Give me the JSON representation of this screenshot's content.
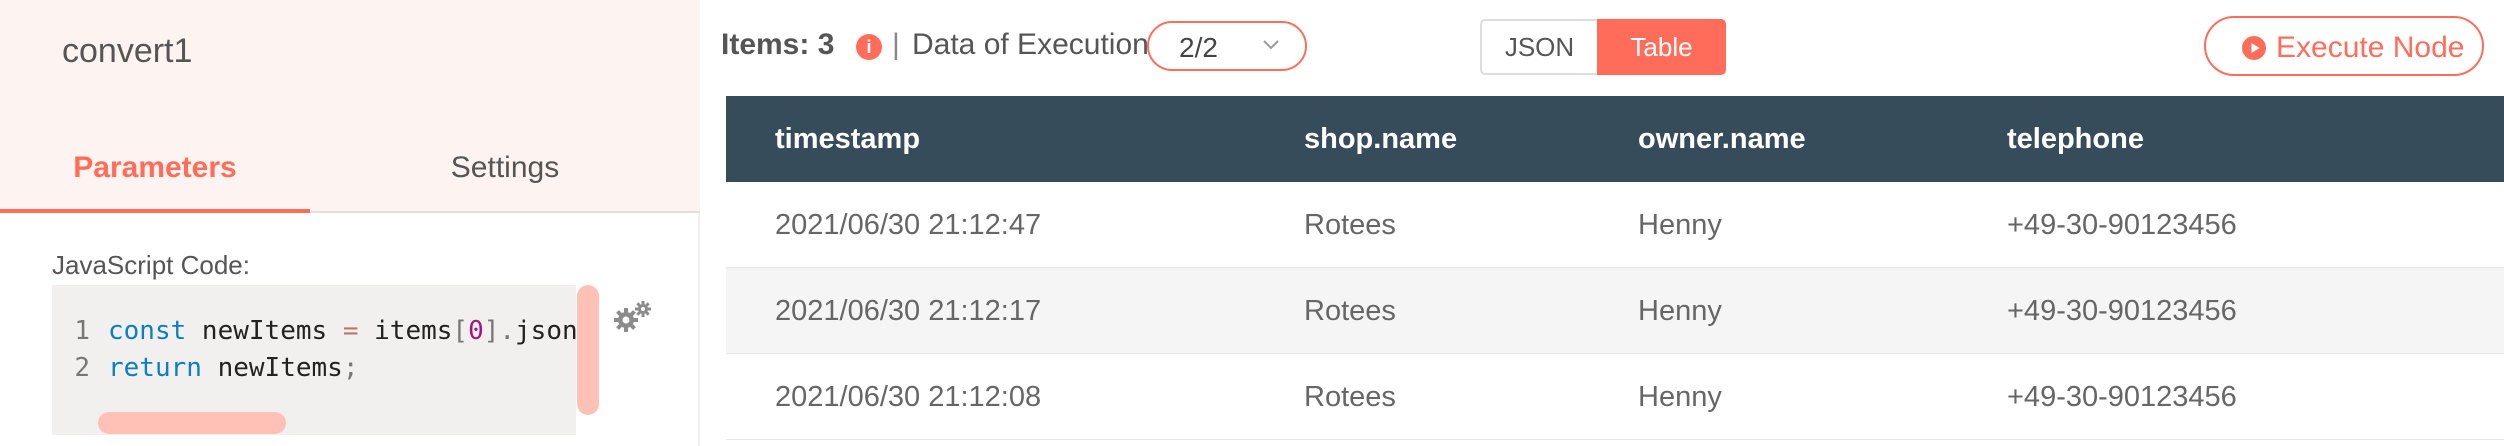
{
  "node": {
    "title": "convert1"
  },
  "tabs": [
    {
      "label": "Parameters",
      "active": true
    },
    {
      "label": "Settings",
      "active": false
    }
  ],
  "parameter": {
    "label": "JavaScript Code:",
    "code_lines": [
      {
        "number": "1",
        "text": "const newItems = items[0].json"
      },
      {
        "number": "2",
        "text": "return newItems;"
      }
    ],
    "code_tokens": {
      "l1_kw": "const",
      "l1_id": " newItems ",
      "l1_op": "=",
      "l1_id2": " items",
      "l1_br_open": "[",
      "l1_num": "0",
      "l1_br_close": "]",
      "l1_dot": ".",
      "l1_tail": "json",
      "l2_kw": "return",
      "l2_id": " newItems",
      "l2_semi": ";"
    },
    "settings_icon": "gears-icon"
  },
  "output": {
    "items_label": "Items: 3",
    "info_icon": "info-icon",
    "separator": "|",
    "execution_label": "Data of Execution:",
    "execution_selected": "2/2",
    "view_modes": [
      "JSON",
      "Table"
    ],
    "active_view": "Table",
    "execute_button": "Execute Node",
    "execute_icon": "play-circle-icon"
  },
  "table": {
    "columns": [
      "timestamp",
      "shop.name",
      "owner.name",
      "telephone"
    ],
    "rows": [
      [
        "2021/06/30 21:12:47",
        "Rotees",
        "Henny",
        "+49-30-90123456"
      ],
      [
        "2021/06/30 21:12:17",
        "Rotees",
        "Henny",
        "+49-30-90123456"
      ],
      [
        "2021/06/30 21:12:08",
        "Rotees",
        "Henny",
        "+49-30-90123456"
      ]
    ]
  },
  "colors": {
    "accent": "#ff6d5a",
    "table_header": "#374c5b",
    "left_header_bg": "#fdf3f0",
    "scrollbar": "#ffc0b6"
  }
}
